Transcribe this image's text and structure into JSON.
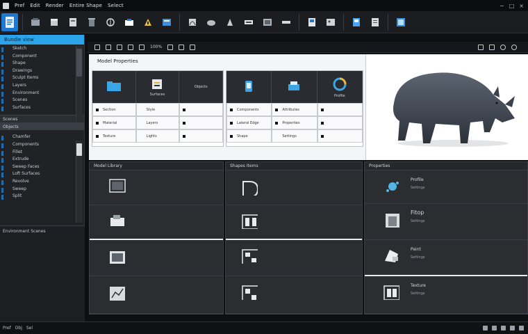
{
  "menubar": {
    "items": [
      "Pref",
      "Edit",
      "Render",
      "Entire Shape",
      "Select"
    ],
    "window_controls": [
      "−",
      "□",
      "×"
    ]
  },
  "ribbon": {
    "buttons": [
      "file-icon",
      "layer-icon",
      "cube-icon",
      "sphere-icon",
      "trash-icon",
      "cut-icon",
      "rotate-icon",
      "scale-icon",
      "warning-icon",
      "curve-icon",
      "render-icon",
      "grid-icon",
      "sphere-icon",
      "cone-icon",
      "mesh-icon",
      "bone-icon",
      "toolbar-icon",
      "image-icon",
      "save-icon",
      "sheet-icon",
      "panel-icon",
      "export-icon"
    ],
    "active_index": 0
  },
  "left_panel": {
    "header": "Bundle view",
    "items_top": [
      "Sketch",
      "Component",
      "Shape",
      "Drawings",
      "Sculpt Items",
      "Layers",
      "Environment",
      "Scenes",
      "Surfaces"
    ],
    "section_1": "Scenes",
    "section_2": "Objects",
    "items_bottom": [
      "Chamfer",
      "Components",
      "Fillet",
      "Extrude",
      "Sweep Faces",
      "Loft Surfaces",
      "Revolve",
      "Sweep",
      "Split"
    ],
    "bottom_caption": "Environment Scenes"
  },
  "viewbar": {
    "label": "100%"
  },
  "white_area": {
    "title": "Model Properties",
    "panel_a": {
      "head": [
        {
          "icon": "folder-icon",
          "label": ""
        },
        {
          "icon": "clipboard-icon",
          "label": "Surfaces"
        },
        {
          "icon": "",
          "label": "Objects"
        }
      ],
      "rows": [
        [
          "Section",
          "Style",
          ""
        ],
        [
          "Material",
          "Layers",
          ""
        ],
        [
          "Texture",
          "Lights",
          ""
        ]
      ]
    },
    "panel_b": {
      "head": [
        {
          "icon": "phone-icon",
          "label": ""
        },
        {
          "icon": "printer-icon",
          "label": ""
        },
        {
          "icon": "swirl-icon",
          "label": "Profile"
        }
      ],
      "rows": [
        [
          "Components",
          "Attributes",
          ""
        ],
        [
          "Lateral Edge",
          "Properties",
          ""
        ],
        [
          "Shape",
          "Settings",
          ""
        ]
      ]
    }
  },
  "render": {
    "subject": "rhino-model"
  },
  "bottom": {
    "panel_1": {
      "title": "Model Library",
      "rows": [
        "monitor-icon",
        "printer-icon",
        "camera-icon",
        "chart-icon"
      ]
    },
    "panel_2": {
      "title": "Shapes Items",
      "rows": [
        "d-shape-icon",
        "box-icon",
        "grid-icon",
        "grid-icon"
      ]
    },
    "panel_3": {
      "title": "Properties",
      "rows": [
        {
          "icon": "splash-icon",
          "label": "Profile",
          "sub": "Settings"
        },
        {
          "icon": "box-icon",
          "label": "Fitop",
          "sub": "Settings"
        },
        {
          "icon": "hand-icon",
          "label": "Paint",
          "sub": "Settings"
        },
        {
          "icon": "grid-icon",
          "label": "Texture",
          "sub": "Settings"
        }
      ]
    }
  },
  "status": {
    "items": [
      "Pref",
      "Obj",
      "Sel"
    ],
    "accent": "#2ba3e8"
  }
}
